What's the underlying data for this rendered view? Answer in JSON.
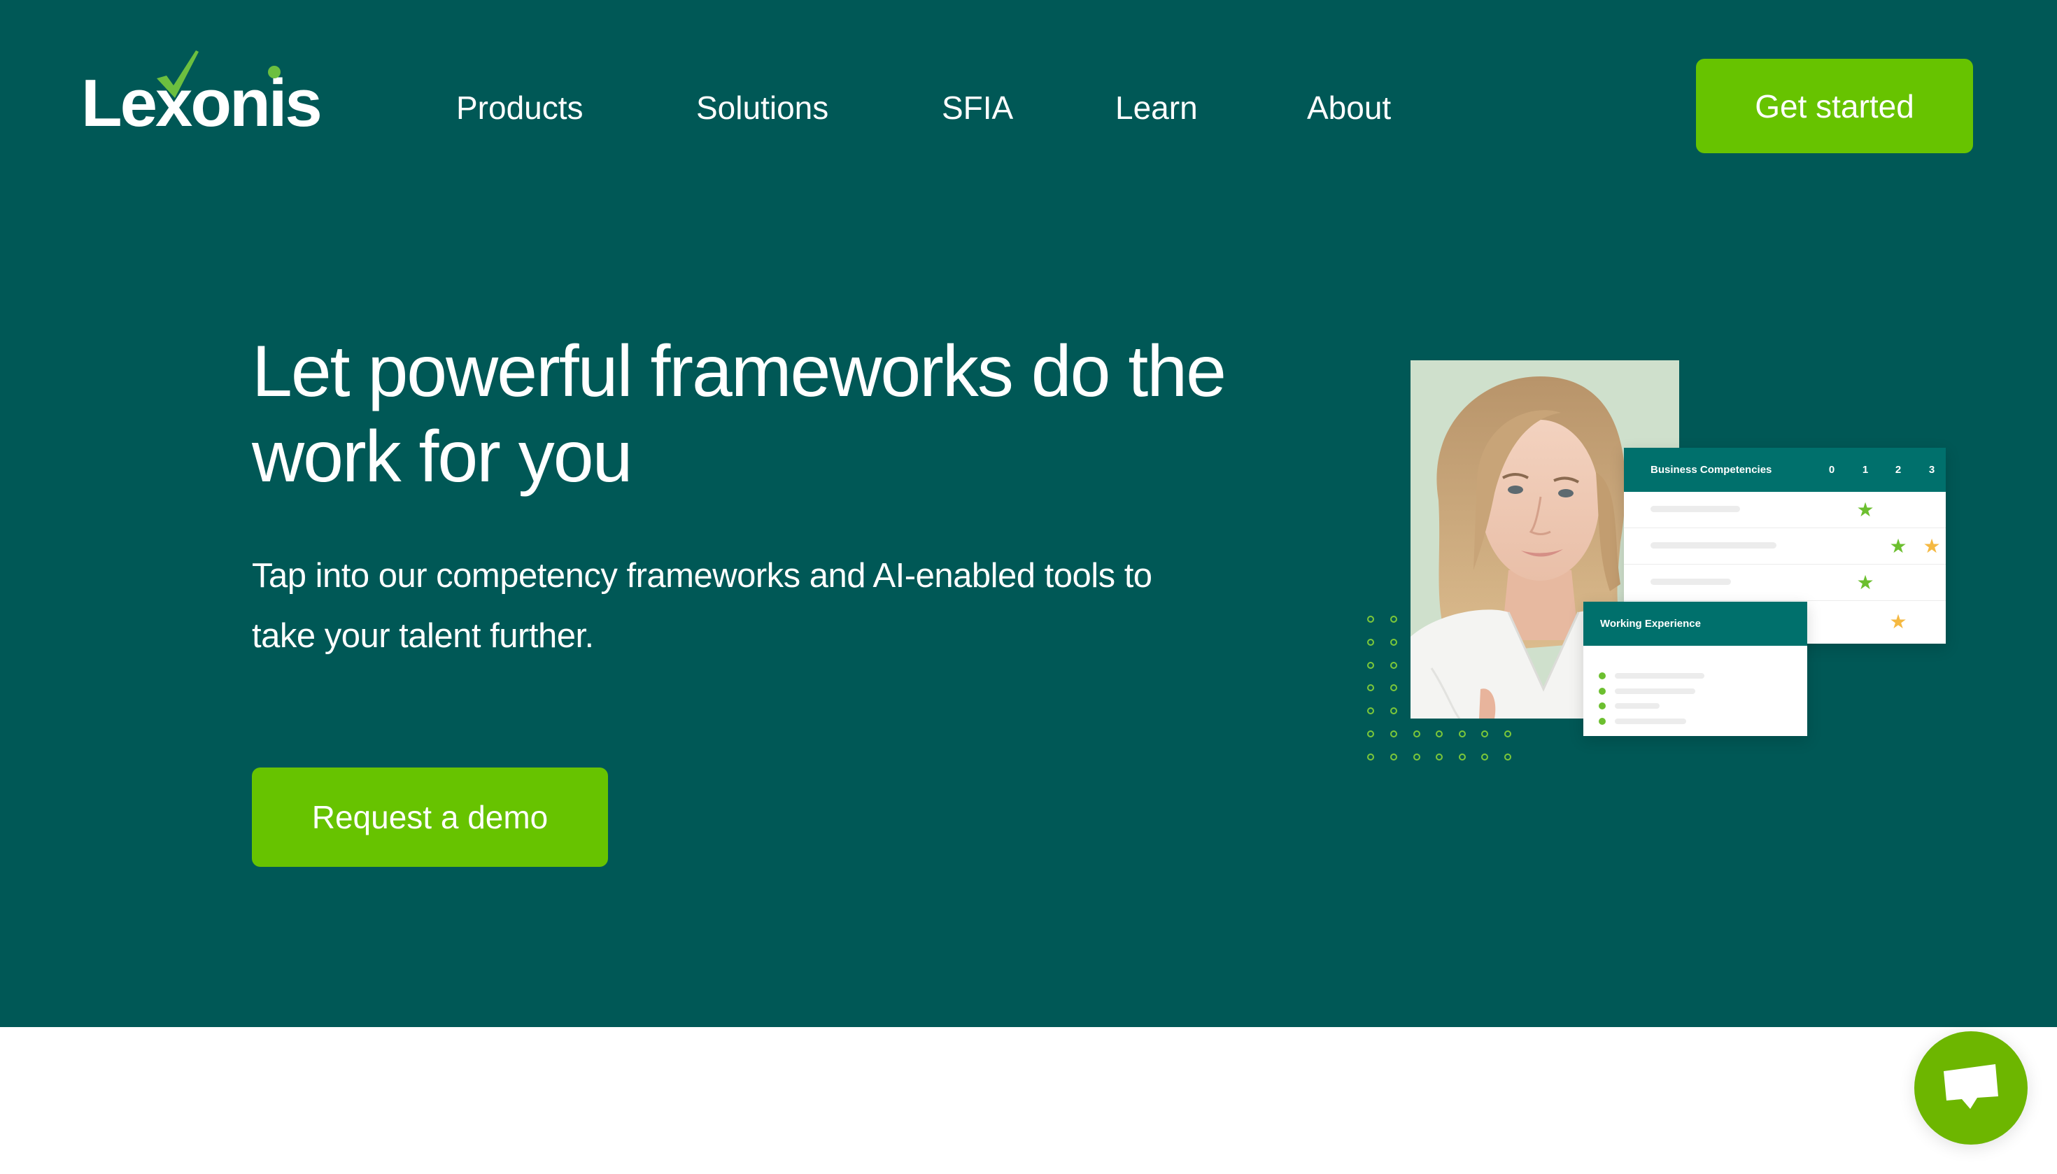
{
  "brand": {
    "name": "Lexonis",
    "logo_parts": {
      "before": "Le",
      "x": "x",
      "after": "onis"
    }
  },
  "colors": {
    "hero_background": "#005856",
    "accent_green": "#67c300",
    "card_header": "#00706c",
    "star_green": "#6cbf2f",
    "star_orange": "#f5b942",
    "photo_background": "#cfe0cc"
  },
  "nav": {
    "items": [
      {
        "label": "Products"
      },
      {
        "label": "Solutions"
      },
      {
        "label": "SFIA"
      },
      {
        "label": "Learn"
      },
      {
        "label": "About"
      }
    ],
    "cta_label": "Get started"
  },
  "hero": {
    "headline_line1": "Let powerful frameworks do the",
    "headline_line2": "work for you",
    "subtitle_line1": "Tap into our competency frameworks and AI-enabled tools to",
    "subtitle_line2": "take your talent further.",
    "cta_label": "Request a demo"
  },
  "illustration": {
    "photo_alt": "Smiling woman with blonde hair in a white blouse",
    "competencies_card": {
      "title": "Business Competencies",
      "levels": [
        "0",
        "1",
        "2",
        "3"
      ],
      "rows": [
        {
          "stars": [
            {
              "level": 1,
              "color": "green"
            }
          ]
        },
        {
          "stars": [
            {
              "level": 2,
              "color": "green"
            },
            {
              "level": 3,
              "color": "orange"
            }
          ]
        },
        {
          "stars": [
            {
              "level": 1,
              "color": "green"
            }
          ]
        },
        {
          "stars": [
            {
              "level": 2,
              "color": "orange"
            }
          ]
        }
      ]
    },
    "experience_card": {
      "title": "Working Experience",
      "item_count": 4
    }
  },
  "chat": {
    "icon": "chat-bubble-icon",
    "label": "Open chat"
  }
}
